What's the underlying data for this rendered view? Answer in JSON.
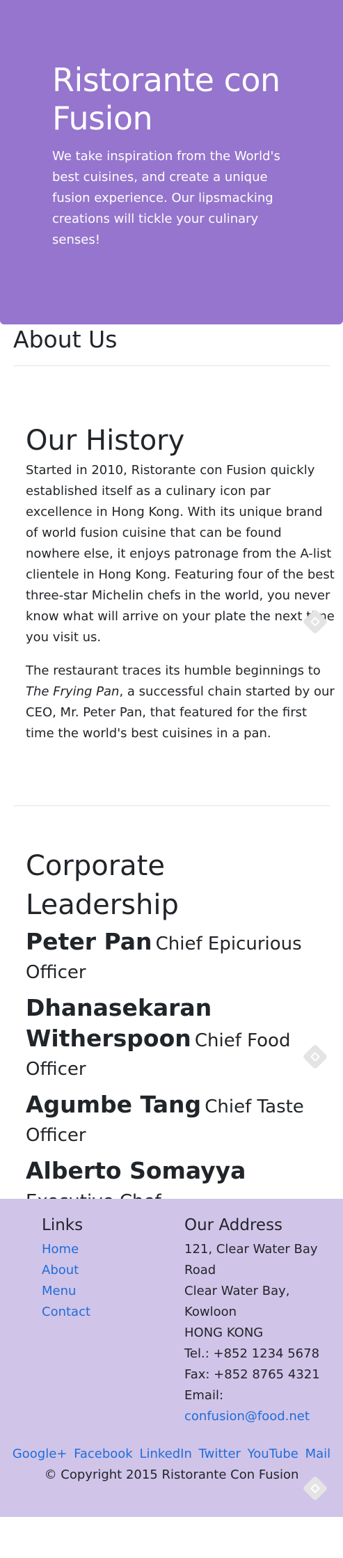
{
  "hero": {
    "title": "Ristorante con Fusion",
    "subtitle": "We take inspiration from the World's best cuisines, and create a unique fusion experience. Our lipsmacking creations will tickle your culinary senses!"
  },
  "about": {
    "title": "About Us"
  },
  "history": {
    "title": "Our History",
    "para1": "Started in 2010, Ristorante con Fusion quickly established itself as a culinary icon par excellence in Hong Kong. With its unique brand of world fusion cuisine that can be found nowhere else, it enjoys patronage from the A-list clientele in Hong Kong. Featuring four of the best three-star Michelin chefs in the world, you never know what will arrive on your plate the next time you visit us.",
    "para2_before": "The restaurant traces its humble beginnings to ",
    "para2_em": "The Frying Pan",
    "para2_after": ", a successful chain started by our CEO, Mr. Peter Pan, that featured for the first time the world's best cuisines in a pan."
  },
  "leadership": {
    "title": "Corporate Leadership",
    "leaders": [
      {
        "name": "Peter Pan",
        "role": "Chief Epicurious Officer"
      },
      {
        "name": "Dhanasekaran Witherspoon",
        "role": "Chief Food Officer"
      },
      {
        "name": "Agumbe Tang",
        "role": "Chief Taste Officer"
      },
      {
        "name": "Alberto Somayya",
        "role": "Executive Chef"
      }
    ]
  },
  "footer": {
    "links_title": "Links",
    "links": [
      "Home",
      "About",
      "Menu",
      "Contact"
    ],
    "address_title": "Our Address",
    "address_lines": [
      "121, Clear Water Bay Road",
      "Clear Water Bay, Kowloon",
      "HONG KONG"
    ],
    "tel": "Tel.: +852 1234 5678",
    "fax": "Fax: +852 8765 4321",
    "email_label": "Email:",
    "email": "confusion@food.net",
    "social": [
      "Google+",
      "Facebook",
      "LinkedIn",
      "Twitter",
      "YouTube",
      "Mail"
    ],
    "copyright": "© Copyright 2015 Ristorante Con Fusion"
  },
  "colors": {
    "hero_bg": "#9575cd",
    "footer_bg": "#d1c4e9",
    "link": "#1e6dd9"
  }
}
